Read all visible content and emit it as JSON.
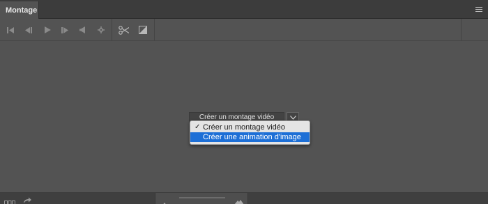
{
  "panel": {
    "tab_label": "Montage"
  },
  "toolbar": {
    "buttons": [
      {
        "icon": "first-frame-icon"
      },
      {
        "icon": "step-back-icon"
      },
      {
        "icon": "play-icon"
      },
      {
        "icon": "step-forward-icon"
      },
      {
        "icon": "audio-icon"
      },
      {
        "icon": "settings-icon"
      },
      {
        "icon": "scissors-icon"
      },
      {
        "icon": "transition-icon"
      }
    ]
  },
  "dropdown": {
    "current_value": "Créer un montage vidéo",
    "options": [
      {
        "label": "Créer un montage vidéo",
        "checked": true,
        "highlighted": false
      },
      {
        "label": "Créer une animation d'image",
        "checked": false,
        "highlighted": true
      }
    ]
  },
  "colors": {
    "highlight": "#1d6fd6",
    "panel_bg": "#535353",
    "tabbar_bg": "#3c3c3c"
  }
}
